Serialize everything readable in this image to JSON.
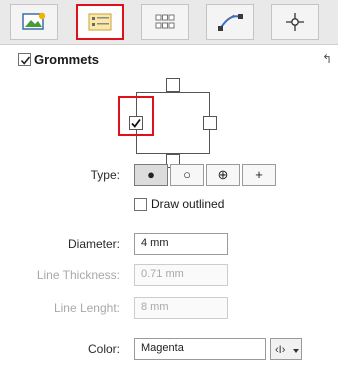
{
  "toolbar": {
    "tabs": [
      {
        "icon": "image-settings-icon",
        "selected": false
      },
      {
        "icon": "grommet-layout-icon",
        "selected": true
      },
      {
        "icon": "grid-icon",
        "selected": false
      },
      {
        "icon": "curve-icon",
        "selected": false
      },
      {
        "icon": "target-icon",
        "selected": false
      }
    ]
  },
  "section": {
    "title": "Grommets",
    "checked": true,
    "reset_icon": "reset-arrow-icon"
  },
  "type": {
    "label": "Type:",
    "options": [
      {
        "icon": "filled-circle-icon",
        "symbol": "●",
        "active": true
      },
      {
        "icon": "hollow-circle-icon",
        "symbol": "○",
        "active": false
      },
      {
        "icon": "crosshair-circle-icon",
        "symbol": "⊕",
        "active": false
      },
      {
        "icon": "plus-icon",
        "symbol": "+",
        "active": false
      }
    ],
    "draw_outlined_label": "Draw outlined",
    "draw_outlined_checked": false
  },
  "fields": {
    "diameter_label": "Diameter:",
    "diameter_value": "4 mm",
    "line_thickness_label": "Line Thickness:",
    "line_thickness_value": "0.71 mm",
    "line_length_label": "Line Lenght:",
    "line_length_value": "8 mm",
    "color_label": "Color:",
    "color_value": "Magenta"
  },
  "colors": {
    "highlight": "#e0101a"
  }
}
